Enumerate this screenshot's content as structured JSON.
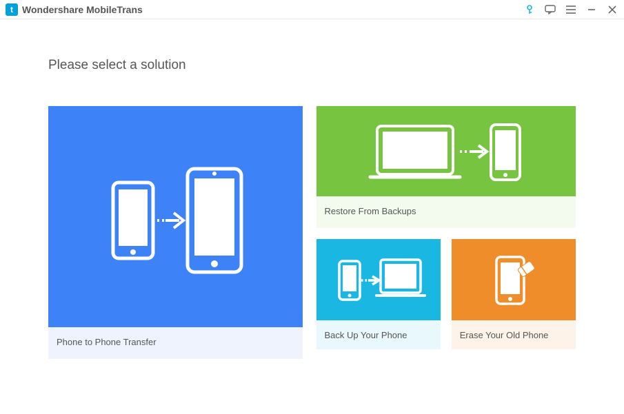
{
  "app": {
    "title": "Wondershare MobileTrans"
  },
  "heading": "Please select a solution",
  "cards": {
    "phone_to_phone": {
      "label": "Phone to Phone Transfer"
    },
    "restore": {
      "label": "Restore From Backups"
    },
    "backup": {
      "label": "Back Up Your Phone"
    },
    "erase": {
      "label": "Erase Your Old Phone"
    }
  }
}
